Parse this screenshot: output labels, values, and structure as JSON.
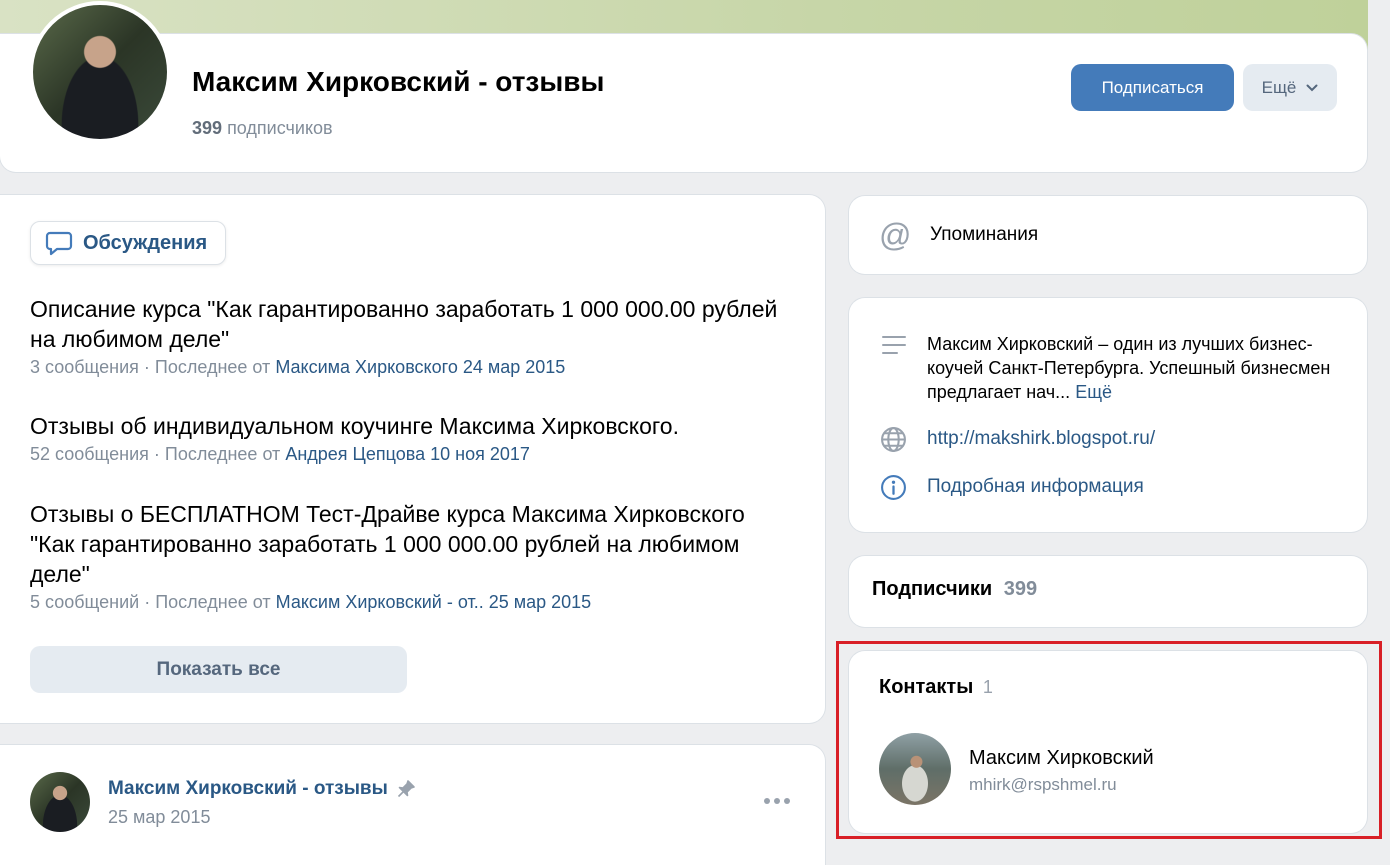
{
  "header": {
    "title": "Максим Хирковский - отзывы",
    "subscribers_count": "399",
    "subscribers_label": "подписчиков",
    "subscribe_button": "Подписаться",
    "more_button": "Ещё"
  },
  "discussions": {
    "tab_label": "Обсуждения",
    "topics": [
      {
        "title": "Описание курса \"Как гарантированно заработать 1 000 000.00 рублей на любимом деле\"",
        "meta_prefix": "3 сообщения · Последнее от",
        "author": "Максима Хирковского",
        "date": "24 мар 2015"
      },
      {
        "title": "Отзывы об индивидуальном коучинге Максима Хирковского.",
        "meta_prefix": "52 сообщения · Последнее от",
        "author": "Андрея Цепцова",
        "date": "10 ноя 2017"
      },
      {
        "title": "Отзывы о БЕСПЛАТНОМ Тест-Драйве курса Максима Хирковского \"Как гарантированно заработать 1 000 000.00 рублей на любимом деле\"",
        "meta_prefix": "5 сообщений · Последнее от",
        "author": "Максим Хирковский - от..",
        "date": "25 мар 2015"
      }
    ],
    "show_all": "Показать все"
  },
  "post": {
    "author": "Максим Хирковский - отзывы",
    "date": "25 мар 2015"
  },
  "sidebar": {
    "mentions_label": "Упоминания",
    "description": "Максим Хирковский – один из лучших бизнес-коучей Санкт-Петербурга. Успешный бизнесмен предлагает нач...",
    "description_more": "Ещё",
    "website": "http://makshirk.blogspot.ru/",
    "details": "Подробная информация",
    "subscribers_title": "Подписчики",
    "subscribers_count": "399",
    "contacts_title": "Контакты",
    "contacts_count": "1",
    "contact": {
      "name": "Максим Хирковский",
      "email": "mhirk@rspshmel.ru"
    }
  },
  "colors": {
    "accent": "#447bba",
    "link": "#2a5885",
    "highlight": "#d81f26"
  }
}
